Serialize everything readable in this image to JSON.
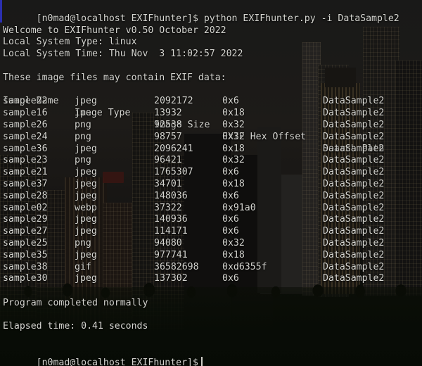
{
  "terminal": {
    "prompt": "[n0mad@localhost EXIFhunter]$",
    "command": "python EXIFhunter.py -i DataSample2",
    "command_line": "[n0mad@localhost EXIFhunter]$ python EXIFhunter.py -i DataSample2",
    "final_prompt": "[n0mad@localhost EXIFhunter]$",
    "accent_color": "#2b2fb0",
    "text_color": "#d6d6d1",
    "background_color": "#0d0d0c"
  },
  "program": {
    "welcome": "Welcome to EXIFhunter v0.50 October 2022",
    "system_type": "Local System Type: linux",
    "system_time": "Local System Time: Thu Nov  3 11:02:57 2022",
    "table_intro": "These image files may contain EXIF data:",
    "completion": "Program completed normally",
    "elapsed": "Elapsed time: 0.41 seconds"
  },
  "table": {
    "headers": {
      "name": "Image Name",
      "type": "Image Type",
      "size": "Image Size",
      "offset": "EXIF Hex Offset",
      "path": "Search Path"
    },
    "rows": [
      {
        "name": "sample22",
        "type": "jpeg",
        "size": "2092172",
        "offset": "0x6",
        "path": "DataSample2"
      },
      {
        "name": "sample16",
        "type": "jpeg",
        "size": "13932",
        "offset": "0x18",
        "path": "DataSample2"
      },
      {
        "name": "sample26",
        "type": "png",
        "size": "92538",
        "offset": "0x32",
        "path": "DataSample2"
      },
      {
        "name": "sample24",
        "type": "png",
        "size": "98757",
        "offset": "0x32",
        "path": "DataSample2"
      },
      {
        "name": "sample36",
        "type": "jpeg",
        "size": "2096241",
        "offset": "0x18",
        "path": "DataSample2"
      },
      {
        "name": "sample23",
        "type": "png",
        "size": "96421",
        "offset": "0x32",
        "path": "DataSample2"
      },
      {
        "name": "sample21",
        "type": "jpeg",
        "size": "1765307",
        "offset": "0x6",
        "path": "DataSample2"
      },
      {
        "name": "sample37",
        "type": "jpeg",
        "size": "34701",
        "offset": "0x18",
        "path": "DataSample2"
      },
      {
        "name": "sample28",
        "type": "jpeg",
        "size": "148036",
        "offset": "0x6",
        "path": "DataSample2"
      },
      {
        "name": "sample02",
        "type": "webp",
        "size": "37322",
        "offset": "0x91a0",
        "path": "DataSample2"
      },
      {
        "name": "sample29",
        "type": "jpeg",
        "size": "140936",
        "offset": "0x6",
        "path": "DataSample2"
      },
      {
        "name": "sample27",
        "type": "jpeg",
        "size": "114171",
        "offset": "0x6",
        "path": "DataSample2"
      },
      {
        "name": "sample25",
        "type": "png",
        "size": "94080",
        "offset": "0x32",
        "path": "DataSample2"
      },
      {
        "name": "sample35",
        "type": "jpeg",
        "size": "977741",
        "offset": "0x18",
        "path": "DataSample2"
      },
      {
        "name": "sample38",
        "type": "gif",
        "size": "36582698",
        "offset": "0xd6355f",
        "path": "DataSample2"
      },
      {
        "name": "sample30",
        "type": "jpeg",
        "size": "137302",
        "offset": "0x6",
        "path": "DataSample2"
      }
    ]
  }
}
